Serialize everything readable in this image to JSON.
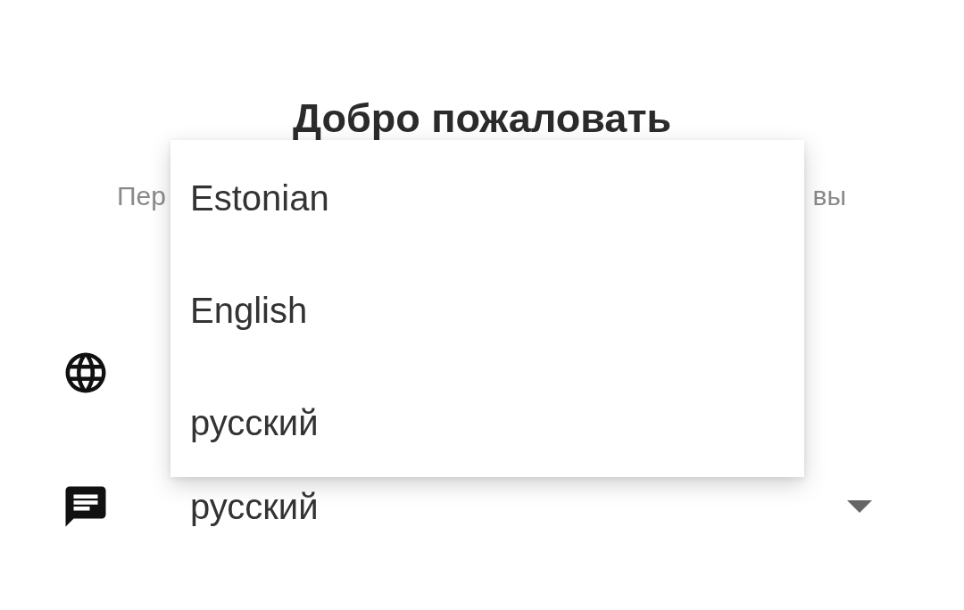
{
  "title": "Добро пожаловать",
  "subtitle": {
    "start": "Пер",
    "end": "вы"
  },
  "fields": [
    {
      "kind": "globe"
    },
    {
      "kind": "message",
      "value": "русский",
      "dropdown": true
    }
  ],
  "menu": {
    "items": [
      {
        "label": "Estonian"
      },
      {
        "label": "English"
      },
      {
        "label": "русский"
      }
    ]
  }
}
